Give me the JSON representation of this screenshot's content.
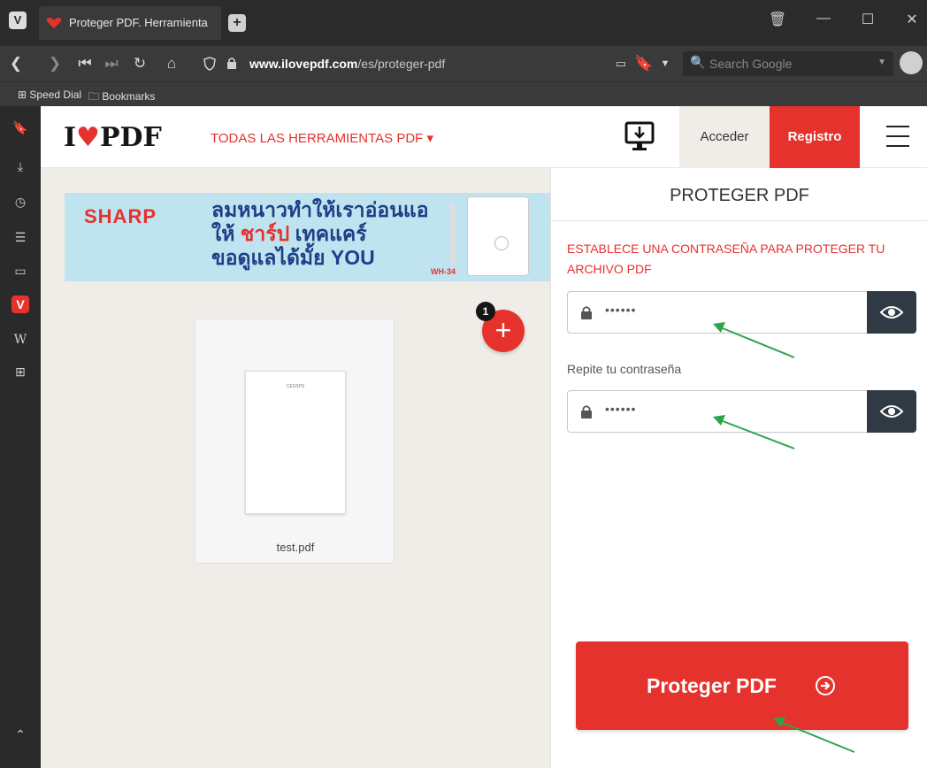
{
  "browser": {
    "tab_title": "Proteger PDF. Herramienta",
    "url_host": "www.ilovepdf.com",
    "url_path": "/es/proteger-pdf",
    "search_placeholder": "Search Google",
    "bookmarks": [
      "Speed Dial",
      "Bookmarks"
    ]
  },
  "header": {
    "logo_left": "I",
    "logo_right": "PDF",
    "tools_menu": "TODAS LAS HERRAMIENTAS PDF",
    "login": "Acceder",
    "signup": "Registro"
  },
  "ad": {
    "brand": "SHARP",
    "line1": "ลมหนาวทำให้เราอ่อนแอ",
    "line2_a": "ให้ ",
    "line2_b": "ชาร์ป",
    "line2_c": " เทคแคร์",
    "line3": "ขอดูแลได้มั้ย YOU",
    "model": "WH-34"
  },
  "workspace": {
    "file_count": "1",
    "file_name": "test.pdf",
    "thumb_text": "CESSPS"
  },
  "panel": {
    "title": "PROTEGER PDF",
    "instruction": "ESTABLECE UNA CONTRASEÑA PARA PROTEGER TU ARCHIVO PDF",
    "password_value": "••••••",
    "repeat_label": "Repite tu contraseña",
    "repeat_value": "••••••",
    "submit": "Proteger PDF"
  },
  "colors": {
    "brand_red": "#e5322d",
    "annotation_green": "#2ea44f"
  }
}
